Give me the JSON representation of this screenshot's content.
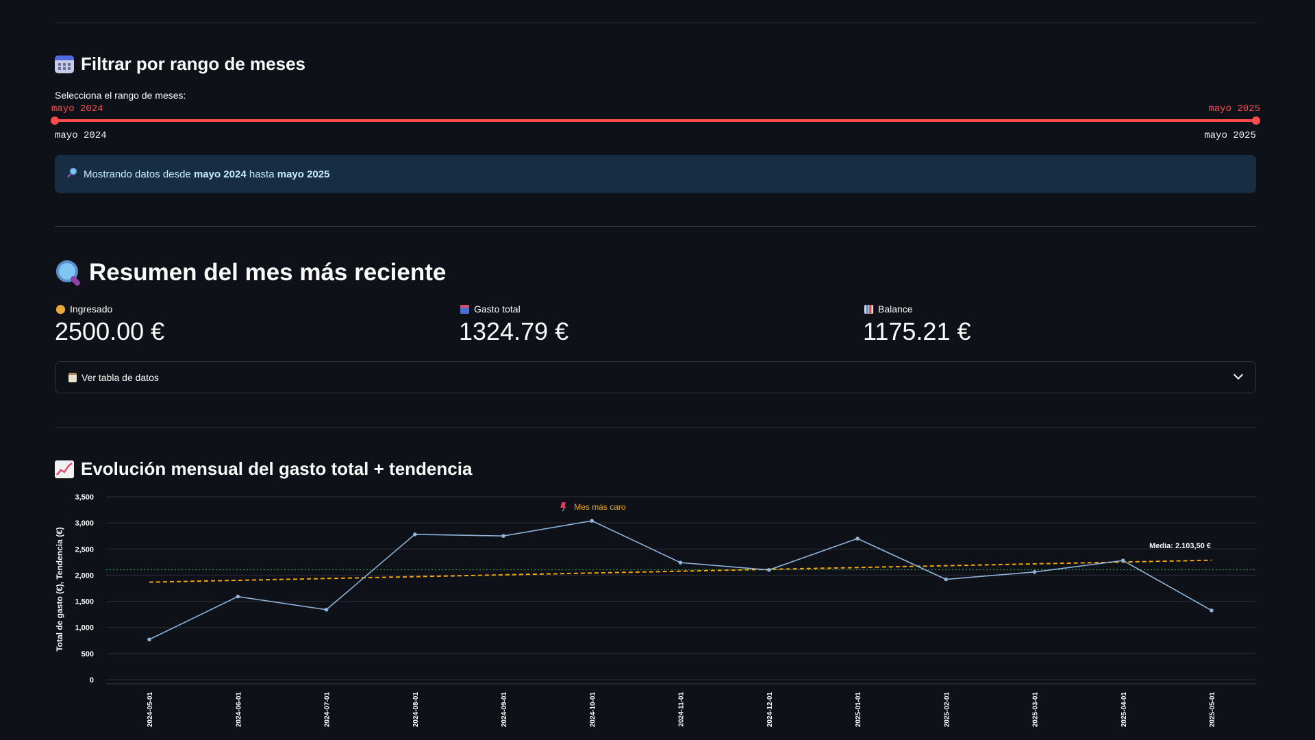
{
  "filter": {
    "heading": "Filtrar por rango de meses",
    "slider_label": "Selecciona el rango de meses:",
    "selected_start": "mayo 2024",
    "selected_end": "mayo 2025",
    "min_label": "mayo 2024",
    "max_label": "mayo 2025",
    "accent_color": "#ff4b4b"
  },
  "info_box": {
    "icon": "magnifier-icon",
    "prefix": "Mostrando datos desde",
    "start": "mayo 2024",
    "middle": "hasta",
    "end": "mayo 2025"
  },
  "summary": {
    "heading": "Resumen del mes más reciente",
    "metrics": [
      {
        "icon": "money-bag-icon",
        "label": "Ingresado",
        "value": "2500.00 €"
      },
      {
        "icon": "spending-icon",
        "label": "Gasto total",
        "value": "1324.79 €"
      },
      {
        "icon": "bar-chart-icon",
        "label": "Balance",
        "value": "1175.21 €"
      }
    ],
    "expander_label": "Ver tabla de datos"
  },
  "evolution": {
    "heading": "Evolución mensual del gasto total + tendencia"
  },
  "chart_data": {
    "type": "line",
    "title": "",
    "ylabel": "Total de gasto (€), Tendencia (€)",
    "xlabel": "",
    "ylim": [
      0,
      3500
    ],
    "yticks": [
      0,
      500,
      1000,
      1500,
      2000,
      2500,
      3000,
      3500
    ],
    "ytick_labels": [
      "0",
      "500",
      "1,000",
      "1,500",
      "2,000",
      "2,500",
      "3,000",
      "3,500"
    ],
    "x": [
      "2024-05-01",
      "2024-06-01",
      "2024-07-01",
      "2024-08-01",
      "2024-09-01",
      "2024-10-01",
      "2024-11-01",
      "2024-12-01",
      "2025-01-01",
      "2025-02-01",
      "2025-03-01",
      "2025-04-01",
      "2025-05-01"
    ],
    "series": [
      {
        "values": [
          770,
          1590,
          1340,
          2780,
          2750,
          3040,
          2240,
          2100,
          2700,
          1920,
          2060,
          2280,
          1325
        ],
        "color": "#8fb4d9",
        "style": "solid"
      },
      {
        "values": [
          1866,
          1901,
          1936,
          1971,
          2006,
          2041,
          2076,
          2111,
          2146,
          2181,
          2216,
          2251,
          2286
        ],
        "color": "#f2a60c",
        "style": "dashed"
      }
    ],
    "mean_line": {
      "value": 2103.5,
      "color": "#2e9e50",
      "style": "dotted",
      "label": "Media: 2.103,50 €"
    },
    "annotation": {
      "text": "Mes más caro",
      "icon": "pushpin-icon",
      "color": "#f2a60c",
      "x": "2024-10-01"
    },
    "grid": true
  }
}
